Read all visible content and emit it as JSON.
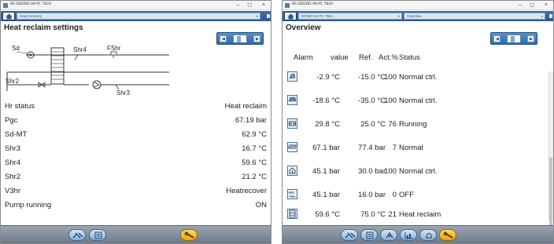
{
  "left_window": {
    "title": "BS DDDDD AK-PC 782A",
    "breadcrumb": "Heat recovery",
    "section_title": "Heat reclaim settings",
    "schematic_labels": {
      "sd": "Sd",
      "shr4": "Shr4",
      "fshr": "FShr",
      "shr2": "Shr2",
      "shr3": "Shr3"
    },
    "rows": [
      {
        "label": "Hr status",
        "value": "Heat reclaim"
      },
      {
        "label": "Pgc",
        "value": "67.19 bar"
      },
      {
        "label": "Sd-MT",
        "value": "62.9 °C"
      },
      {
        "label": "Shr3",
        "value": "16.7 °C"
      },
      {
        "label": "Shr4",
        "value": "59.6 °C"
      },
      {
        "label": "Shr2",
        "value": "21.2 °C"
      },
      {
        "label": "V3hr",
        "value": "Heatrecover"
      },
      {
        "label": "Pump running",
        "value": "ON"
      }
    ],
    "footer_icons": [
      "tools-icon",
      "list-icon",
      "wrench-icon"
    ]
  },
  "right_window": {
    "title": "BS DDDDD AK-PC 782A",
    "breadcrumb_device": "00:000 AK-PC 782A",
    "breadcrumb_view": "Overview",
    "section_title": "Overview",
    "headers": {
      "alarm": "Alarm",
      "value": "value",
      "ref": "Ref.",
      "act": "Act.%",
      "status": "Status"
    },
    "rows": [
      {
        "icon": "cabinet-icon",
        "value": "-2.9 °C",
        "ref": "-15.0 °C",
        "act": "100",
        "status": "Normal ctrl."
      },
      {
        "icon": "freezer-icon",
        "value": "-18.6 °C",
        "ref": "-35.0 °C",
        "act": "100",
        "status": "Normal ctrl."
      },
      {
        "icon": "compressor-icon",
        "value": "29.8 °C",
        "ref": "25.0 °C",
        "act": "76",
        "status": "Running"
      },
      {
        "icon": "condenser-icon",
        "value": "67.1 bar",
        "ref": "77.4 bar",
        "act": "7",
        "status": "Normal"
      },
      {
        "icon": "receiver-icon",
        "value": "45.1 bar",
        "ref": "30.0 bar",
        "act": "100",
        "status": "Normal ctrl."
      },
      {
        "icon": "hg-valve-icon",
        "value": "45.1 bar",
        "ref": "16.0 bar",
        "act": "0",
        "status": "OFF"
      },
      {
        "icon": "heat-reclaim-icon",
        "value": "59.6 °C",
        "ref": "75.0 °C",
        "act": "21",
        "status": "Heat reclaim"
      }
    ],
    "hg_icon_text": "HG",
    "footer_icons": [
      "tools-icon",
      "list-icon",
      "defrost-icon",
      "chart-icon",
      "bell-icon",
      "wrench-icon"
    ]
  },
  "colors": {
    "nav_blue": "#2d5b8f",
    "accent_orange": "#e8a610"
  }
}
